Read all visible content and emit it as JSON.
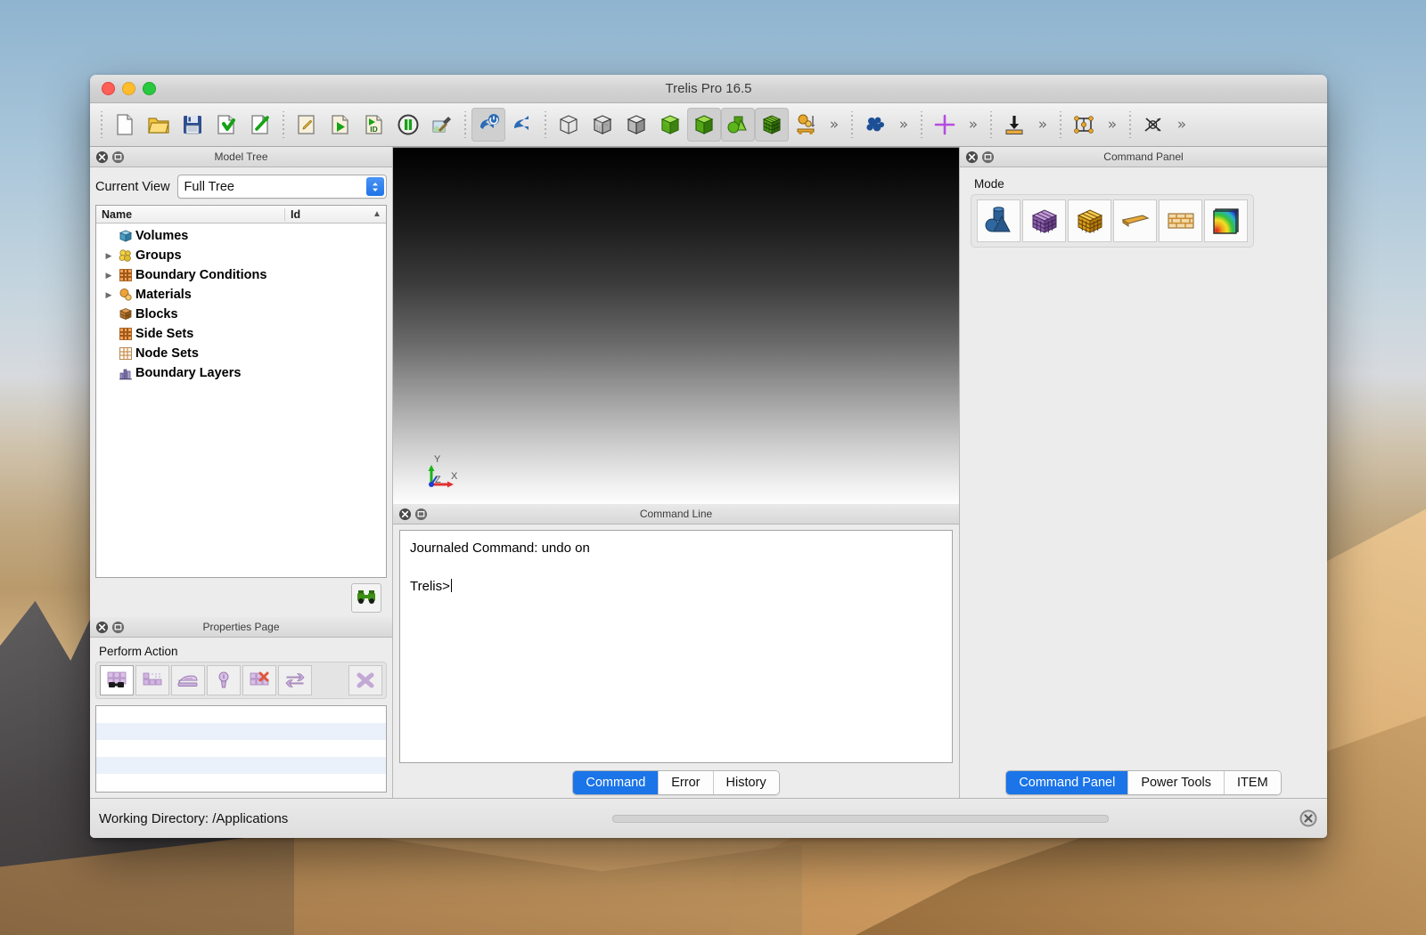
{
  "window": {
    "title": "Trelis Pro 16.5",
    "traffic_lights": [
      "close",
      "minimize",
      "zoom"
    ]
  },
  "toolbar": {
    "groups": [
      {
        "name": "file-group",
        "items": [
          {
            "name": "new-file-icon",
            "label": "New"
          },
          {
            "name": "open-folder-icon",
            "label": "Open"
          },
          {
            "name": "save-floppy-icon",
            "label": "Save"
          },
          {
            "name": "import-file-icon",
            "label": "Import"
          },
          {
            "name": "export-file-icon",
            "label": "Export"
          }
        ]
      },
      {
        "name": "journal-group",
        "items": [
          {
            "name": "edit-journal-icon",
            "label": "Edit Journal File"
          },
          {
            "name": "play-journal-icon",
            "label": "Play Journal File"
          },
          {
            "name": "id-journal-icon",
            "label": "Journal Ids"
          },
          {
            "name": "pause-icon",
            "label": "Pause"
          },
          {
            "name": "build-hammer-icon",
            "label": "Build"
          }
        ]
      },
      {
        "name": "undo-group",
        "items": [
          {
            "name": "undo-toggle-icon",
            "label": "Undo On",
            "active": true
          },
          {
            "name": "undo-arrow-icon",
            "label": "Undo"
          }
        ]
      },
      {
        "name": "display-group",
        "items": [
          {
            "name": "wireframe-cube-icon",
            "label": "Wireframe"
          },
          {
            "name": "hidden-line-cube-icon",
            "label": "Hidden Line"
          },
          {
            "name": "shaded-grey-cube-icon",
            "label": "Shaded"
          },
          {
            "name": "smooth-shade-cube-icon",
            "label": "Smooth Shade"
          },
          {
            "name": "solid-green-cube-icon",
            "label": "Solid Shade",
            "active": true
          },
          {
            "name": "composite-geometry-icon",
            "label": "Geometry",
            "active": true
          },
          {
            "name": "mesh-cube-icon",
            "label": "Mesh",
            "active": true
          },
          {
            "name": "materials-icon",
            "label": "Materials"
          }
        ]
      },
      {
        "name": "extra-group",
        "items": [
          {
            "name": "blue-cluster-icon",
            "label": "Groups"
          },
          {
            "name": "purple-cross-icon",
            "label": "Vertex"
          },
          {
            "name": "down-arrow-bar-icon",
            "label": "Surface"
          },
          {
            "name": "node-frame-icon",
            "label": "Nodes"
          },
          {
            "name": "cross-arrows-icon",
            "label": "Disable"
          }
        ]
      }
    ],
    "chevron_label": "»"
  },
  "model_tree": {
    "panel_title": "Model Tree",
    "current_view_label": "Current View",
    "current_view_value": "Full Tree",
    "columns": [
      "Name",
      "Id"
    ],
    "sort_indicator": "▲",
    "rows": [
      {
        "label": "Volumes",
        "icon": "volume-cube-icon",
        "expandable": false
      },
      {
        "label": "Groups",
        "icon": "groups-icon",
        "expandable": true
      },
      {
        "label": "Boundary Conditions",
        "icon": "boundary-conditions-icon",
        "expandable": true
      },
      {
        "label": "Materials",
        "icon": "materials-sphere-icon",
        "expandable": true
      },
      {
        "label": "Blocks",
        "icon": "blocks-icon",
        "expandable": false
      },
      {
        "label": "Side Sets",
        "icon": "side-sets-icon",
        "expandable": false
      },
      {
        "label": "Node Sets",
        "icon": "node-sets-icon",
        "expandable": false
      },
      {
        "label": "Boundary Layers",
        "icon": "boundary-layers-icon",
        "expandable": false
      }
    ],
    "footer_button": {
      "name": "tree-search-icon",
      "label": "Find"
    }
  },
  "properties_page": {
    "panel_title": "Properties Page",
    "section_label": "Perform Action",
    "actions": [
      {
        "name": "inspect-mesh-icon",
        "label": "Inspect",
        "selected": true
      },
      {
        "name": "mesh-quality-icon",
        "label": "Quality"
      },
      {
        "name": "smooth-iron-icon",
        "label": "Smooth"
      },
      {
        "name": "mesh-node-icon",
        "label": "Node"
      },
      {
        "name": "delete-mesh-icon",
        "label": "Delete Mesh"
      },
      {
        "name": "refresh-swap-icon",
        "label": "Swap"
      }
    ],
    "close_action": {
      "name": "close-x-icon",
      "label": "Close"
    },
    "list_rows": 5
  },
  "viewport": {
    "name": "graphics-viewport",
    "axes": [
      {
        "axis": "X",
        "color": "#e03030"
      },
      {
        "axis": "Y",
        "color": "#19b319"
      },
      {
        "axis": "Z",
        "color": "#1d3fd0"
      }
    ],
    "background_top": "#000000",
    "background_bottom": "#ffffff"
  },
  "command_line": {
    "panel_title": "Command Line",
    "output_line": "Journaled Command: undo on",
    "prompt": "Trelis>",
    "tabs": [
      {
        "label": "Command",
        "active": true
      },
      {
        "label": "Error",
        "active": false
      },
      {
        "label": "History",
        "active": false
      }
    ]
  },
  "command_panel": {
    "panel_title": "Command Panel",
    "mode_label": "Mode",
    "modes": [
      {
        "name": "geometry-mode-icon",
        "label": "Geometry"
      },
      {
        "name": "mesh-purple-mode-icon",
        "label": "Mesh"
      },
      {
        "name": "mesh-orange-mode-icon",
        "label": "Mesh Quality"
      },
      {
        "name": "boundary-plate-mode-icon",
        "label": "Boundary Conditions"
      },
      {
        "name": "material-brick-mode-icon",
        "label": "Materials"
      },
      {
        "name": "analysis-color-mode-icon",
        "label": "Analysis Groups"
      }
    ],
    "tabs": [
      {
        "label": "Command Panel",
        "active": true
      },
      {
        "label": "Power Tools",
        "active": false
      },
      {
        "label": "ITEM",
        "active": false
      }
    ]
  },
  "status_bar": {
    "working_directory": "Working Directory: /Applications",
    "progress_percent": 0,
    "stop_button": {
      "name": "stop-button",
      "label": "Stop"
    }
  },
  "colors": {
    "accent_blue": "#1b74e8",
    "window_chrome": "#ececec",
    "panel_header": "#dcdcdc"
  }
}
